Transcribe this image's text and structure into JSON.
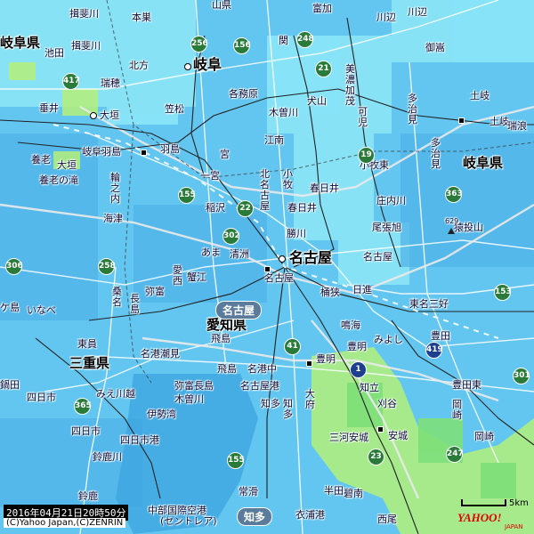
{
  "map": {
    "timestamp": "2016年04月21日20時50分",
    "copyright": "(C)Yahoo Japan,(C)ZENRIN",
    "logo": "YAHOO!",
    "logo_sub": "JAPAN",
    "scale_label": "5km",
    "colors": {
      "background": "#62c6f0",
      "rain_light": "#8ee8f8",
      "rain_green": "#b4f07a",
      "rail": "#222222",
      "road": "#ffffff"
    },
    "prefectures": [
      "岐阜県",
      "岐阜県",
      "愛知県",
      "三重県"
    ],
    "areas": [
      "名古屋",
      "知多"
    ],
    "mountain": "猿投山",
    "mountain_height": "629",
    "shields": {
      "national": [
        "417",
        "256",
        "156",
        "248",
        "21",
        "19",
        "363",
        "22",
        "302",
        "155",
        "258",
        "306",
        "365",
        "23",
        "41",
        "153",
        "301",
        "1",
        "247",
        "155"
      ],
      "expressway": [
        "1",
        "419",
        "23",
        "248"
      ]
    },
    "places": [
      "揖斐川",
      "本巣",
      "山県",
      "関",
      "富加",
      "川辺",
      "川辺",
      "池田",
      "揖斐川",
      "北方",
      "岐阜",
      "美濃加茂",
      "御嵩",
      "瑞穂",
      "各務原",
      "犬山",
      "多治見",
      "土岐",
      "大垣",
      "垂井",
      "笠松",
      "木曽川",
      "可児",
      "土岐",
      "瑞浪",
      "岐阜羽島",
      "羽島",
      "江南",
      "小牧",
      "小牧東",
      "多治見",
      "養老",
      "大垣",
      "宮",
      "春日井",
      "岐阜県",
      "養老の滝",
      "輪之内",
      "北名古屋",
      "一宮",
      "稲沢",
      "春日井",
      "庄内川",
      "海津",
      "あま",
      "清洲",
      "勝川",
      "尾張旭",
      "猿投山",
      "愛西",
      "名古屋",
      "名古屋",
      "蟹江",
      "弥富",
      "名古屋",
      "桶狭",
      "日進",
      "東名三好",
      "ケ島",
      "長島",
      "桑名",
      "いなべ",
      "鳴海",
      "豊明",
      "みよし",
      "豊田",
      "愛知県",
      "飛島",
      "東員",
      "名港中",
      "名港潮見",
      "豊明",
      "東員",
      "三重県",
      "飛島",
      "鍋田",
      "弥富長島",
      "知立",
      "豊田東",
      "四日市",
      "みえ川越",
      "木曽川",
      "名古屋港",
      "大府",
      "亀野",
      "四日市",
      "伊勢湾",
      "知多",
      "刈谷",
      "岡崎",
      "三河安城",
      "安城",
      "岡崎",
      "四日市港",
      "四日市",
      "安城",
      "鈴鹿川",
      "西尾",
      "鈴鹿",
      "常滑",
      "半田",
      "碧南",
      "中部国際空港",
      "(セントレア)",
      "衣浦港",
      "西尾"
    ]
  }
}
